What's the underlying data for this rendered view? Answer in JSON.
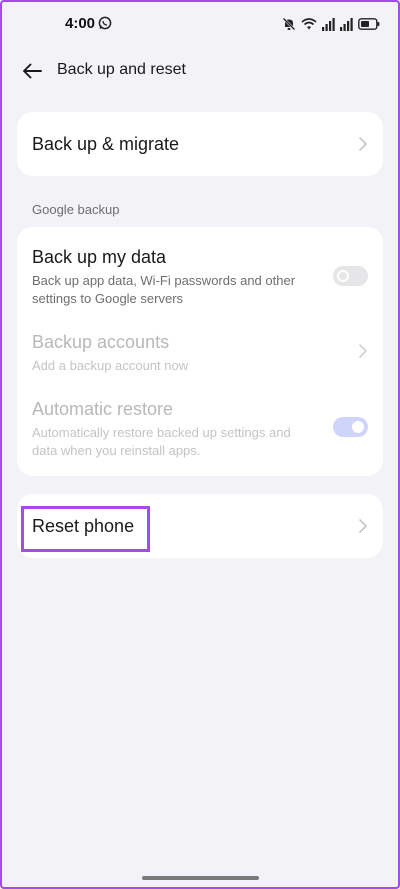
{
  "status_bar": {
    "time": "4:00",
    "icons": [
      "whatsapp-icon",
      "mute-icon",
      "wifi-icon",
      "signal-icon",
      "signal-icon",
      "battery-icon"
    ]
  },
  "app_bar": {
    "back_icon": "arrow-left-icon",
    "title": "Back up and reset"
  },
  "migrate_card": {
    "title": "Back up & migrate"
  },
  "google_backup": {
    "section_label": "Google backup",
    "back_up_my_data": {
      "title": "Back up my data",
      "description": "Back up app data, Wi-Fi passwords and other settings to Google servers",
      "toggle_state": "off"
    },
    "backup_accounts": {
      "title": "Backup accounts",
      "description": "Add a backup account now",
      "enabled": false
    },
    "automatic_restore": {
      "title": "Automatic restore",
      "description": "Automatically restore backed up settings and data when you reinstall apps.",
      "toggle_state": "on",
      "enabled": false
    }
  },
  "reset_card": {
    "title": "Reset phone"
  },
  "colors": {
    "background": "#f3f2f6",
    "card": "#ffffff",
    "highlight": "#a24bf0",
    "toggle_on": "#cfd5fa"
  }
}
